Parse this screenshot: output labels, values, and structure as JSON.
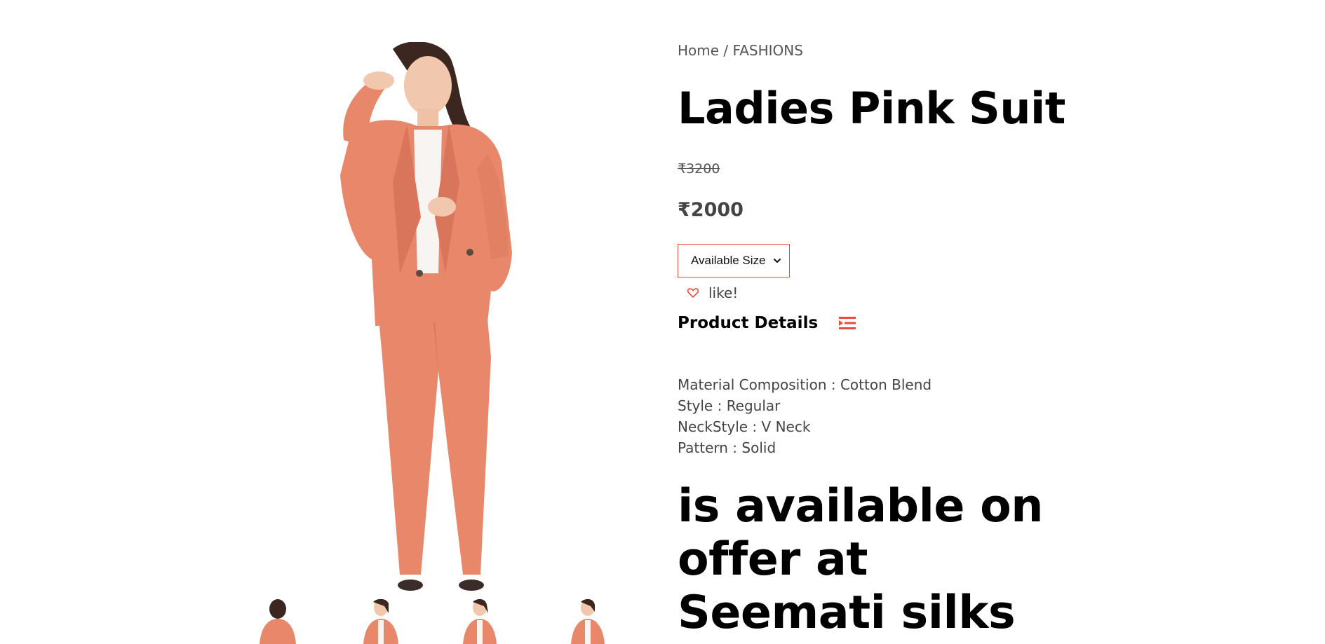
{
  "breadcrumb": {
    "home": "Home",
    "separator": "/",
    "category": "FASHIONS"
  },
  "product": {
    "title": "Ladies Pink Suit",
    "old_price": "₹3200",
    "price": "₹2000",
    "image_icon": "model-in-coral-suit-photo"
  },
  "size_select": {
    "selected": "Available Size",
    "icon": "chevron-down-icon"
  },
  "like": {
    "label": "like!",
    "icon": "heart-icon"
  },
  "details": {
    "heading": "Product Details",
    "icon": "list-toggle-icon",
    "items": [
      "Material Composition : Cotton Blend",
      "Style : Regular",
      "NeckStyle : V Neck",
      "Pattern : Solid"
    ]
  },
  "offer": {
    "text": "is available on offer at Seemati silks"
  },
  "thumbnails": {
    "count_visible": 4,
    "icon": "product-thumbnail"
  },
  "colors": {
    "accent": "#e74c3c",
    "suit": "#e9876b",
    "text_dark": "#000000",
    "text_muted": "#555555"
  }
}
